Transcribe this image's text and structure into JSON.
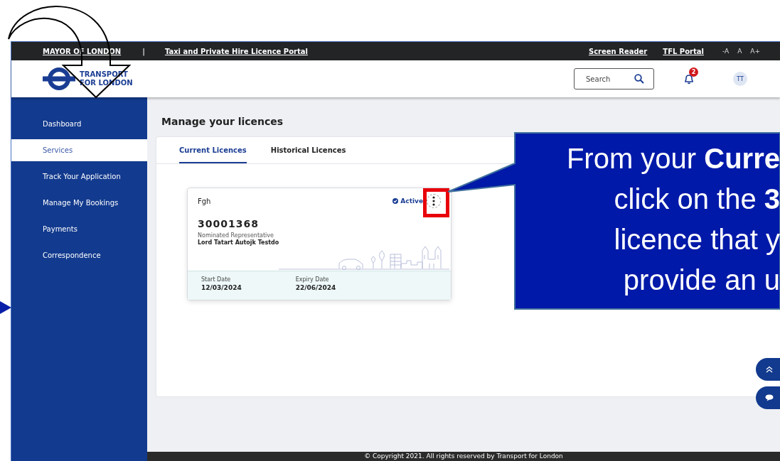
{
  "top_bar": {
    "left_links": [
      "MAYOR OF LONDON",
      "Taxi and Private Hire Licence Portal"
    ],
    "separator": "|",
    "right_links": [
      "Screen Reader",
      "TFL Portal"
    ],
    "text_size_controls": [
      "-A",
      "A",
      "A+"
    ]
  },
  "header": {
    "logo_text": [
      "TRANSPORT",
      "FOR LONDON"
    ],
    "search": {
      "placeholder": "Search"
    },
    "notifications": {
      "count": "2"
    },
    "avatar": "TT"
  },
  "sidebar": {
    "items": [
      {
        "label": "Dashboard",
        "selected": false
      },
      {
        "label": "Services",
        "selected": true
      },
      {
        "label": "Track Your Application",
        "selected": false
      },
      {
        "label": "Manage My Bookings",
        "selected": false
      },
      {
        "label": "Payments",
        "selected": false
      },
      {
        "label": "Correspondence",
        "selected": false
      }
    ]
  },
  "page_title": "Manage your licences",
  "tabs": [
    {
      "label": "Current Licences",
      "selected": true
    },
    {
      "label": "Historical Licences",
      "selected": false
    }
  ],
  "licences": [
    {
      "name": "Fgh",
      "status": "Active",
      "number": "30001368",
      "role": "Nominated Representative",
      "holder": "Lord Tatart Autojk Testdo",
      "start_label": "Start Date",
      "start_date": "12/03/2024",
      "expiry_label": "Expiry Date",
      "expiry_date": "22/06/2024",
      "menu_highlighted": true
    }
  ],
  "footer": "© Copyright 2021. All rights reserved by Transport for London",
  "callout": {
    "lines": [
      "From your **Curre**",
      "click on the **3**",
      "licence that y",
      "provide an u"
    ]
  }
}
